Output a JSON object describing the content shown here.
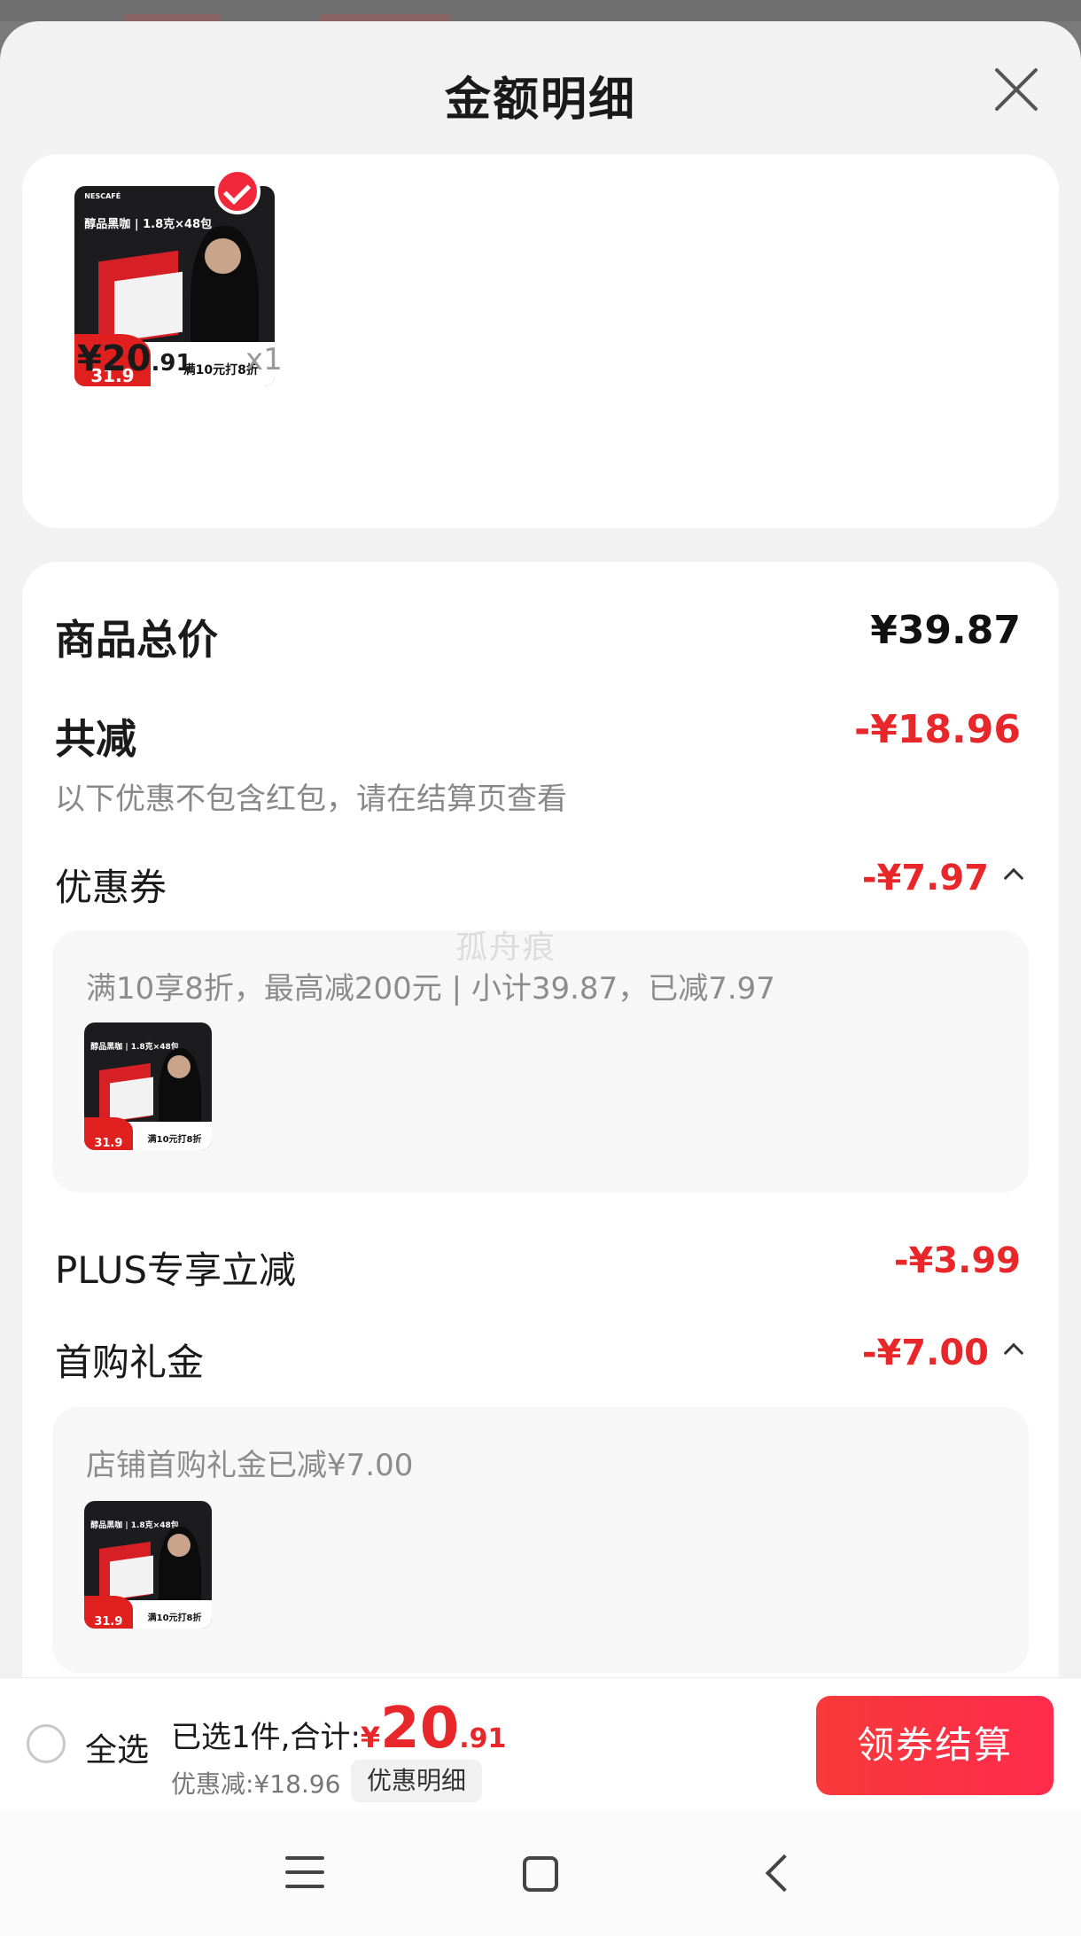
{
  "header": {
    "title": "金额明细"
  },
  "product": {
    "thumbnail": {
      "brand": "NESCAFÉ",
      "headline": "醇品黑咖 | 1.8克×48包",
      "price_badge": "31.9",
      "deal": "满10元打8折"
    },
    "price_int": "¥20",
    "price_dec": ".91",
    "quantity": "x1"
  },
  "detail": {
    "total_label": "商品总价",
    "total_value": "¥39.87",
    "reduction_label": "共减",
    "reduction_value": "-¥18.96",
    "reduction_note": "以下优惠不包含红包，请在结算页查看",
    "coupon": {
      "label": "优惠券",
      "value": "-¥7.97",
      "panel_text": "满10享8折，最高减200元 | 小计39.87，已减7.97"
    },
    "plus": {
      "label": "PLUS专享立减",
      "value": "-¥3.99"
    },
    "first_purchase": {
      "label": "首购礼金",
      "value": "-¥7.00",
      "panel_text": "店铺首购礼金已减¥7.00"
    }
  },
  "watermark": "孤舟痕",
  "bottom_bar": {
    "select_all": "全选",
    "summary_label": "已选1件,合计:",
    "summary_currency": "¥",
    "summary_int": "20",
    "summary_dec": ".91",
    "discount_text": "优惠减:¥18.96",
    "detail_button": "优惠明细",
    "checkout_button": "领券结算"
  },
  "colors": {
    "accent": "#e8272a",
    "checkout": "#f73a3a"
  },
  "icons": [
    "close-icon",
    "check-icon",
    "chevron-up-icon",
    "menu-icon",
    "home-icon",
    "back-icon"
  ]
}
